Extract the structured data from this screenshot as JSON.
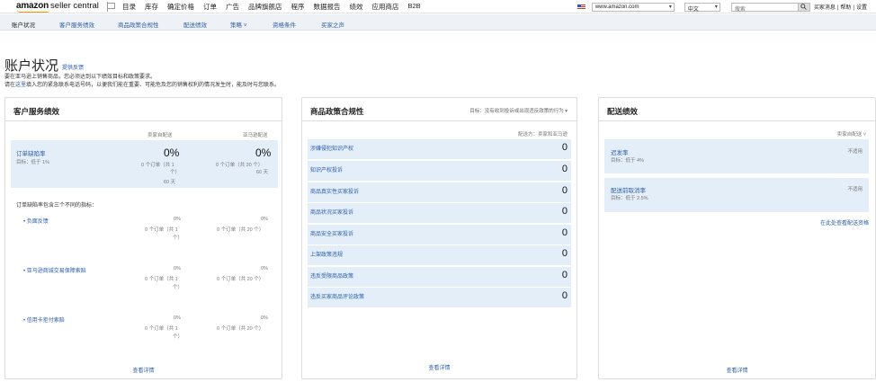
{
  "header": {
    "logo_word": "amazon",
    "logo_word2": "seller central",
    "nav": [
      "目录",
      "库存",
      "确定价格",
      "订单",
      "广告",
      "品牌旗舰店",
      "程序",
      "数据报告",
      "绩效",
      "应用商店",
      "B2B"
    ],
    "marketplace": "www.amazon.com",
    "language": "中文",
    "search_placeholder": "搜索",
    "links": [
      "买家消息",
      "帮助",
      "设置"
    ],
    "link_sep": "|"
  },
  "subnav": [
    "账户状况",
    "客户服务绩效",
    "商品政策合规性",
    "配送绩效",
    "策略 ˅",
    "资格条件",
    "买家之声"
  ],
  "page": {
    "title": "账户状况",
    "feedback": "提供反馈",
    "intro1": "要在亚马逊上销售商品，您必须达到以下绩效目标和政策要求。",
    "intro2_a": "请在",
    "intro2_link": "这里",
    "intro2_b": "填入您的紧急联系电话号码，以便我们能在重要、可能危及您的销售权利的情况发生时，能及时与您联系。"
  },
  "csp": {
    "title": "客户服务绩效",
    "col_seller": "卖家自配送",
    "col_amazon": "亚马逊配送",
    "odr_label": "订单缺陷率",
    "odr_target": "目标：低于 1%",
    "odr_seller_value": "0%",
    "odr_seller_count": "0 个订单（共 1",
    "odr_seller_count2": "个）",
    "odr_seller_days": "60 天",
    "odr_amazon_value": "0%",
    "odr_amazon_count": "0 个订单（共 20 个）",
    "odr_amazon_days": "60 天",
    "odr_desc": "订单缺陷率包含三个不同的指标：",
    "sub_metrics": [
      {
        "label": "负面反馈",
        "seller_value": "0%",
        "seller_count": "0 个订单（共 1",
        "seller_count2": "个）",
        "amazon_value": "0%",
        "amazon_count": "0 个订单（共 20 个）"
      },
      {
        "label": "亚马逊商城交易保障索赔",
        "seller_value": "0%",
        "seller_count": "0 个订单（共 1",
        "seller_count2": "个）",
        "amazon_value": "0%",
        "amazon_count": "0 个订单（共 20 个）"
      },
      {
        "label": "信用卡拒付索赔",
        "seller_value": "0%",
        "seller_count": "0 个订单（共 1",
        "seller_count2": "个）",
        "amazon_value": "0%",
        "amazon_count": "0 个订单（共 20 个）"
      }
    ],
    "details_link": "查看详情"
  },
  "policy": {
    "title": "商品政策合规性",
    "target": "目标：没有收到投诉或出现违反政策的行为",
    "scope": "配送方：卖家和亚马逊",
    "rows": [
      {
        "label": "涉嫌侵犯知识产权",
        "value": "0"
      },
      {
        "label": "知识产权投诉",
        "value": "0"
      },
      {
        "label": "商品真实性买家投诉",
        "value": "0"
      },
      {
        "label": "商品状况买家投诉",
        "value": "0"
      },
      {
        "label": "商品安全买家投诉",
        "value": "0"
      },
      {
        "label": "上架政策违规",
        "value": "0"
      },
      {
        "label": "违反受限商品政策",
        "value": "0"
      },
      {
        "label": "违反买家商品评论政策",
        "value": "0"
      }
    ],
    "details_link": "查看详情"
  },
  "shipping": {
    "title": "配送绩效",
    "filter": "卖家自配送 ˅",
    "rows": [
      {
        "label": "迟发率",
        "target": "目标：低于 4%",
        "value": "不适用"
      },
      {
        "label": "配送前取消率",
        "target": "目标：低于 2.5%",
        "value": "不适用"
      }
    ],
    "eligibility_link": "在此处查看配送资格",
    "details_link": "查看详情"
  }
}
